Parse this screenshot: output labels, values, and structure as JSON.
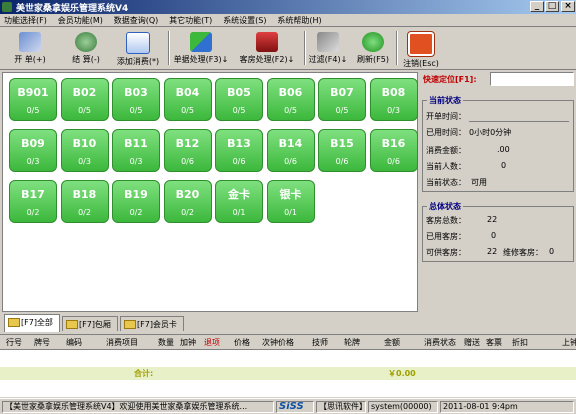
{
  "window": {
    "title": "美世家桑拿娱乐管理系统V4"
  },
  "menu": [
    "功能选择(F)",
    "会员功能(M)",
    "数据查询(Q)",
    "其它功能(T)",
    "系统设置(S)",
    "系统帮助(H)"
  ],
  "toolbar": {
    "open": "开 单(+)",
    "checkout": "结 算(-)",
    "add": "添加消费(*)",
    "single": "单据处理(F3)↓",
    "guest": "客房处理(F2)↓",
    "filter": "过滤(F4)↓",
    "refresh": "刷新(F5)",
    "logout": "注销(Esc)"
  },
  "rooms": [
    {
      "name": "B901",
      "count": "0/5"
    },
    {
      "name": "B02",
      "count": "0/5"
    },
    {
      "name": "B03",
      "count": "0/5"
    },
    {
      "name": "B04",
      "count": "0/5"
    },
    {
      "name": "B05",
      "count": "0/5"
    },
    {
      "name": "B06",
      "count": "0/5"
    },
    {
      "name": "B07",
      "count": "0/5"
    },
    {
      "name": "B08",
      "count": "0/3"
    },
    {
      "name": "B09",
      "count": "0/3"
    },
    {
      "name": "B10",
      "count": "0/3"
    },
    {
      "name": "B11",
      "count": "0/3"
    },
    {
      "name": "B12",
      "count": "0/6"
    },
    {
      "name": "B13",
      "count": "0/6"
    },
    {
      "name": "B14",
      "count": "0/6"
    },
    {
      "name": "B15",
      "count": "0/6"
    },
    {
      "name": "B16",
      "count": "0/6"
    },
    {
      "name": "B17",
      "count": "0/2"
    },
    {
      "name": "B18",
      "count": "0/2"
    },
    {
      "name": "B19",
      "count": "0/2"
    },
    {
      "name": "B20",
      "count": "0/2"
    },
    {
      "name": "金卡",
      "count": "0/1"
    },
    {
      "name": "银卡",
      "count": "0/1"
    }
  ],
  "tabs": [
    "[F7]全部",
    "[F7]包厢",
    "[F7]会员卡"
  ],
  "right": {
    "locate_label": "快速定位[F1]:",
    "current": {
      "title": "当前状态",
      "open_time_label": "开单时间：",
      "open_time_value": "",
      "used_time_label": "已用时间：",
      "used_time_value": "0小时0分钟",
      "amount_label": "消费金额：",
      "amount_value": ".00",
      "people_label": "当前人数：",
      "people_value": "0",
      "state_label": "当前状态：",
      "state_value": "可用"
    },
    "total": {
      "title": "总体状态",
      "rooms_label": "客房总数：",
      "rooms_value": "22",
      "used_label": "已用客房：",
      "used_value": "0",
      "avail_label": "可供客房：",
      "avail_value": "22",
      "repair_label": "维修客房：",
      "repair_value": "0"
    }
  },
  "grid": {
    "headers": [
      "行号",
      "牌号",
      "编码",
      "消费项目",
      "数量",
      "加钟",
      "退项",
      "价格",
      "次钟价格",
      "技师",
      "轮牌",
      "金额",
      "消费状态",
      "赠送",
      "客票",
      "折扣",
      "上钟"
    ],
    "sum_label": "合计:",
    "sum_value": "￥0.00"
  },
  "status": {
    "app": "【美世家桑拿娱乐管理系统V4】欢迎使用美世家桑拿娱乐管理系统...",
    "brand": "SiSS",
    "company": "【思讯软件】",
    "user": "system(00000)",
    "datetime": "2011-08-01 9:4pm"
  },
  "colors": {
    "title_bar": "#0a246a",
    "room_green": "#3cb83c",
    "accent_red": "#c00000",
    "group_title": "#000080"
  }
}
